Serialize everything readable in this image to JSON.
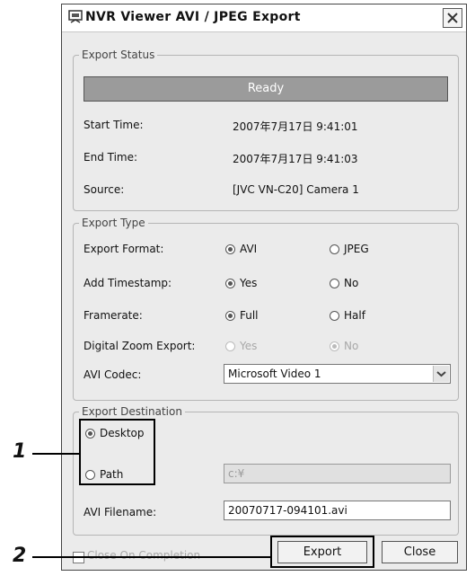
{
  "window": {
    "title": "NVR Viewer AVI / JPEG Export"
  },
  "export_status": {
    "legend": "Export Status",
    "status": "Ready",
    "start_time_label": "Start Time:",
    "start_time_value": "2007年7月17日 9:41:01",
    "end_time_label": "End Time:",
    "end_time_value": "2007年7月17日 9:41:03",
    "source_label": "Source:",
    "source_value": "[JVC VN-C20] Camera 1"
  },
  "export_type": {
    "legend": "Export Type",
    "format_label": "Export Format:",
    "format_opt1": "AVI",
    "format_opt2": "JPEG",
    "timestamp_label": "Add Timestamp:",
    "timestamp_opt1": "Yes",
    "timestamp_opt2": "No",
    "framerate_label": "Framerate:",
    "framerate_opt1": "Full",
    "framerate_opt2": "Half",
    "zoom_label": "Digital Zoom Export:",
    "zoom_opt1": "Yes",
    "zoom_opt2": "No",
    "codec_label": "AVI Codec:",
    "codec_value": "Microsoft Video 1"
  },
  "export_destination": {
    "legend": "Export Destination",
    "desktop": "Desktop",
    "path": "Path",
    "path_value": "c:¥",
    "filename_label": "AVI Filename:",
    "filename_value": "20070717-094101.avi"
  },
  "footer": {
    "close_on_completion": "Close On Completion",
    "export_button": "Export",
    "close_button": "Close"
  },
  "callouts": {
    "one": "1",
    "two": "2"
  }
}
